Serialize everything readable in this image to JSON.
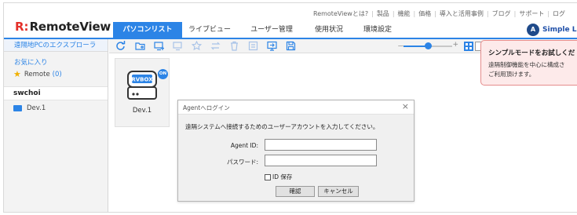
{
  "header": {
    "logo_mark": "R:",
    "logo_name": "RemoteView",
    "top_links": [
      "RemoteViewとは?",
      "製品",
      "機能",
      "価格",
      "導入と活用事例",
      "ブログ",
      "サポート",
      "ログ"
    ],
    "top_link_separator": "|"
  },
  "nav": {
    "tabs": [
      {
        "label": "パソコンリスト",
        "active": true
      },
      {
        "label": "ライブビュー",
        "active": false
      },
      {
        "label": "ユーザー管理",
        "active": false
      },
      {
        "label": "使用状況",
        "active": false
      },
      {
        "label": "環境設定",
        "active": false
      }
    ]
  },
  "user": {
    "avatar_letter": "A",
    "name": "Simple La"
  },
  "sidebar": {
    "header": "遠隔地PCのエクスプローラ",
    "favorites_title": "お気に入り",
    "favorite_item": {
      "label": "Remote",
      "count": "(0)"
    },
    "group_name": "swchoi",
    "device_item": "Dev.1"
  },
  "toolbar": {
    "icons": [
      "refresh-icon",
      "add-folder-icon",
      "add-pc-icon",
      "move-pc-icon",
      "favorite-star-icon",
      "transfer-icon",
      "delete-icon",
      "properties-icon",
      "connect-icon",
      "save-icon"
    ],
    "zoom_minus": "－",
    "zoom_plus": "+",
    "zoom_level": 0.5
  },
  "device_card": {
    "screen_text": "RVBOX",
    "badge": "ON",
    "name": "Dev.1"
  },
  "dialog": {
    "title": "Agentへログイン",
    "close": "×",
    "message": "遠隔システムへ接続するためのユーザーアカウントを入力してください。",
    "agent_id_label": "Agent ID:",
    "agent_id_value": "",
    "password_label": "パスワード:",
    "password_value": "",
    "save_id_label": "ID 保存",
    "ok_label": "確認",
    "cancel_label": "キャンセル"
  },
  "popup": {
    "title": "シンプルモードをお試しくだ",
    "line1": "遠隔制御機能を中心に構成さ",
    "line2": "ご利用頂けます。"
  },
  "colors": {
    "accent": "#2c84e6",
    "brand_red": "#e4302a",
    "popup_bg": "#fdeaea",
    "popup_border": "#e58d8d"
  }
}
